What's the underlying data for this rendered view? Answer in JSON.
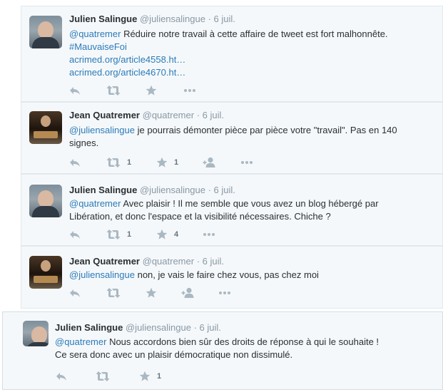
{
  "tweets": [
    {
      "name": "Julien Salingue",
      "handle": "@juliensalingue",
      "time": "· 6 juil.",
      "mention": "@quatremer",
      "text": " Réduire notre travail à cette affaire de tweet est fort malhonnête.",
      "hashtag": "#MauvaiseFoi",
      "link1": "acrimed.org/article4558.ht…",
      "link2": "acrimed.org/article4670.ht…",
      "retweets": "",
      "favorites": ""
    },
    {
      "name": "Jean Quatremer",
      "handle": "@quatremer",
      "time": "· 6 juil.",
      "mention": "@juliensalingue",
      "text_line1": " je pourrais démonter pièce par pièce votre \"travail\". Pas en 140",
      "text_line2": "signes.",
      "retweets": "1",
      "favorites": "1"
    },
    {
      "name": "Julien Salingue",
      "handle": "@juliensalingue",
      "time": "· 6 juil.",
      "mention": "@quatremer",
      "text_line1": " Avec plaisir ! Il me semble que vous avez un blog hébergé par",
      "text_line2": "Libération, et donc l'espace et la visibilité nécessaires. Chiche ?",
      "retweets": "1",
      "favorites": "4"
    },
    {
      "name": "Jean Quatremer",
      "handle": "@quatremer",
      "time": "· 6 juil.",
      "mention": "@juliensalingue",
      "text": " non, je vais le faire chez vous, pas chez moi",
      "retweets": "",
      "favorites": ""
    },
    {
      "name": "Julien Salingue",
      "handle": "@juliensalingue",
      "time": "· 6 juil.",
      "mention": "@quatremer",
      "text_line1": " Nous accordons bien sûr des droits de réponse à qui le souhaite !",
      "text_line2": "Ce sera donc avec un plaisir démocratique non dissimulé.",
      "retweets": "",
      "favorites": "1"
    }
  ],
  "icons": {
    "reply": "reply-icon",
    "retweet": "retweet-icon",
    "favorite": "star-icon",
    "follow": "follow-icon",
    "more": "more-icon"
  },
  "colors": {
    "link": "#2b7bb9",
    "muted": "#8899a6",
    "icon": "#aab8c2",
    "card_bg": "#f5f8fa"
  }
}
